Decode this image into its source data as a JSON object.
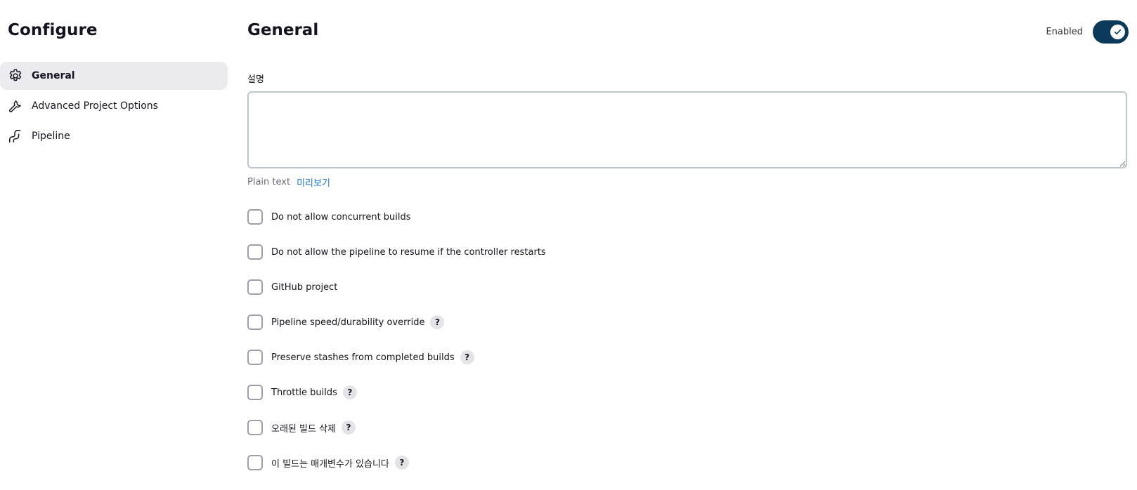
{
  "sidebar": {
    "title": "Configure",
    "items": [
      {
        "label": "General",
        "icon": "gear-icon",
        "active": true
      },
      {
        "label": "Advanced Project Options",
        "icon": "wrench-icon",
        "active": false
      },
      {
        "label": "Pipeline",
        "icon": "pipeline-icon",
        "active": false
      }
    ]
  },
  "main": {
    "title": "General",
    "enabled_label": "Enabled",
    "enabled": true,
    "description": {
      "label": "설명",
      "value": "",
      "plain_text": "Plain text",
      "preview_link": "미리보기"
    },
    "options": [
      {
        "label": "Do not allow concurrent builds",
        "checked": false,
        "help": false
      },
      {
        "label": "Do not allow the pipeline to resume if the controller restarts",
        "checked": false,
        "help": false
      },
      {
        "label": "GitHub project",
        "checked": false,
        "help": false
      },
      {
        "label": "Pipeline speed/durability override",
        "checked": false,
        "help": true
      },
      {
        "label": "Preserve stashes from completed builds",
        "checked": false,
        "help": true
      },
      {
        "label": "Throttle builds",
        "checked": false,
        "help": true
      },
      {
        "label": "오래된 빌드 삭제",
        "checked": false,
        "help": true
      },
      {
        "label": "이 빌드는 매개변수가 있습니다",
        "checked": false,
        "help": true
      }
    ],
    "help_symbol": "?"
  },
  "colors": {
    "toggle_on": "#0b3a5a",
    "active_item_bg": "#ebebf0",
    "link": "#1a73d9"
  }
}
